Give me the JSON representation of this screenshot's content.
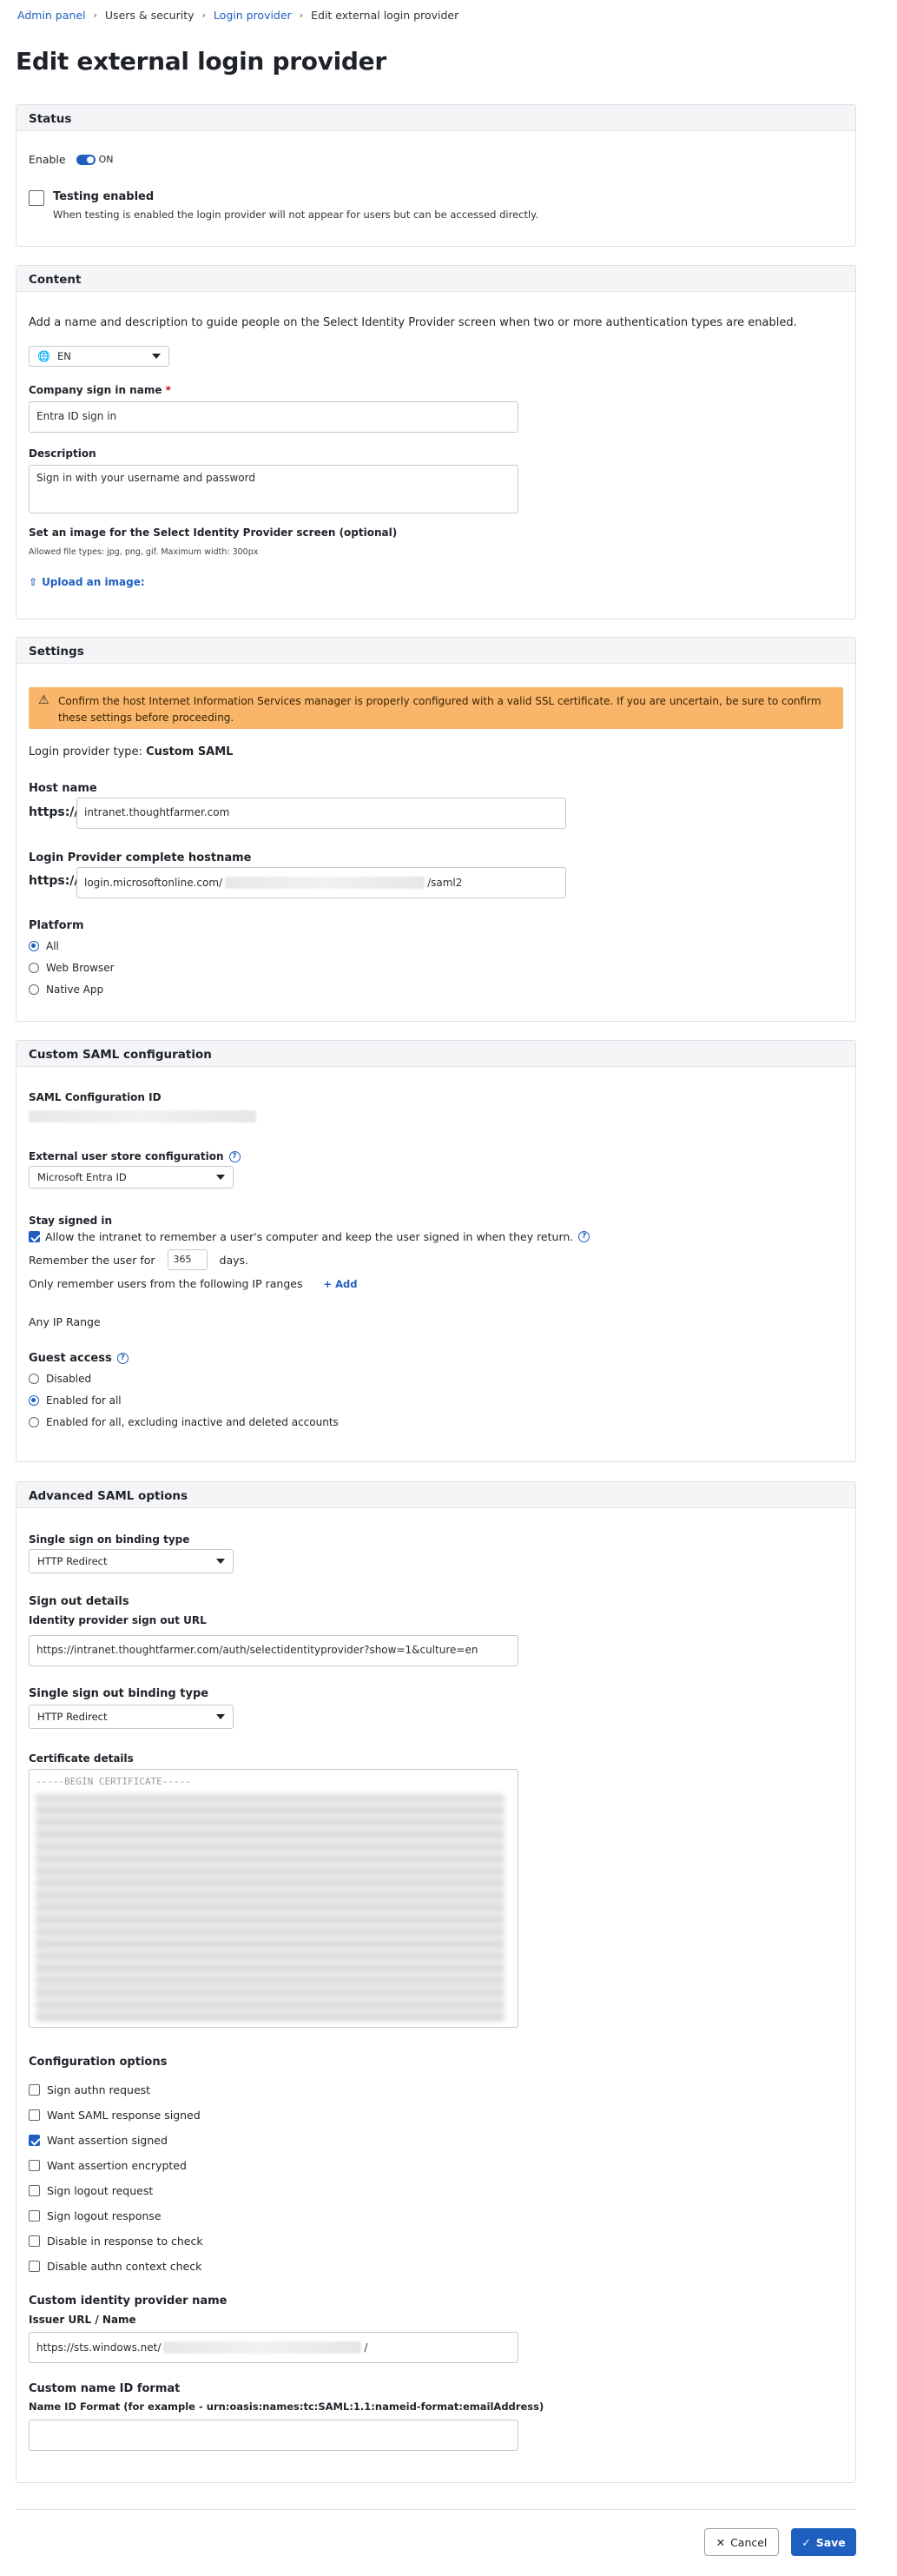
{
  "breadcrumb": {
    "items": [
      "Admin panel",
      "Users & security",
      "Login provider",
      "Edit external login provider"
    ]
  },
  "page_title": "Edit external login provider",
  "status": {
    "title": "Status",
    "enable_label": "Enable",
    "toggle_text": "ON",
    "testing_label": "Testing enabled",
    "testing_help": "When testing is enabled the login provider will not appear for users but can be accessed directly."
  },
  "content": {
    "title": "Content",
    "intro": "Add a name and description to guide people on the Select Identity Provider screen when two or more authentication types are enabled.",
    "language": "EN",
    "company_label": "Company sign in name",
    "required_mark": "*",
    "company_value": "Entra ID sign in",
    "description_label": "Description",
    "description_value": "Sign in with your username and password",
    "image_label": "Set an image for the Select Identity Provider screen (optional)",
    "image_help": "Allowed file types: jpg, png, gif. Maximum width: 300px",
    "upload_label": "Upload an image:"
  },
  "settings": {
    "title": "Settings",
    "warning": "Confirm the host Internet Information Services manager is properly configured with a valid SSL certificate. If you are uncertain, be sure to confirm these settings before proceeding.",
    "type_prefix": "Login provider type:",
    "type_value": "Custom SAML",
    "host_label": "Host name",
    "https": "https://",
    "host_value": "intranet.thoughtfarmer.com",
    "complete_label": "Login Provider complete hostname",
    "complete_prefix": "login.microsoftonline.com/",
    "complete_suffix": "/saml2",
    "platform_label": "Platform",
    "platforms": [
      "All",
      "Web Browser",
      "Native App"
    ]
  },
  "saml": {
    "title": "Custom SAML configuration",
    "config_id_label": "SAML Configuration ID",
    "store_label": "External user store configuration",
    "store_value": "Microsoft Entra ID",
    "stay_label": "Stay signed in",
    "stay_check": "Allow the intranet to remember a user's computer and keep the user signed in when they return.",
    "remember_prefix": "Remember the user for",
    "remember_days": "365",
    "remember_suffix": "days.",
    "ip_label": "Only remember users from the following IP ranges",
    "add_label": "Add",
    "any_ip": "Any IP Range",
    "guest_label": "Guest access",
    "guest_options": [
      "Disabled",
      "Enabled for all",
      "Enabled for all, excluding inactive and deleted accounts"
    ]
  },
  "advanced": {
    "title": "Advanced SAML options",
    "sso_binding_label": "Single sign on binding type",
    "sso_binding_value": "HTTP Redirect",
    "signout_label": "Sign out details",
    "idp_signout_label": "Identity provider sign out URL",
    "idp_signout_value": "https://intranet.thoughtfarmer.com/auth/selectidentityprovider?show=1&culture=en",
    "slo_binding_label": "Single sign out binding type",
    "slo_binding_value": "HTTP Redirect",
    "cert_label": "Certificate details",
    "cert_begin": "-----BEGIN CERTIFICATE-----",
    "config_label": "Configuration options",
    "options": [
      {
        "label": "Sign authn request",
        "checked": false
      },
      {
        "label": "Want SAML response signed",
        "checked": false
      },
      {
        "label": "Want assertion signed",
        "checked": true
      },
      {
        "label": "Want assertion encrypted",
        "checked": false
      },
      {
        "label": "Sign logout request",
        "checked": false
      },
      {
        "label": "Sign logout response",
        "checked": false
      },
      {
        "label": "Disable in response to check",
        "checked": false
      },
      {
        "label": "Disable authn context check",
        "checked": false
      }
    ],
    "idp_name_label": "Custom identity provider name",
    "issuer_label": "Issuer URL / Name",
    "issuer_prefix": "https://sts.windows.net/",
    "issuer_suffix": "/",
    "nameid_title": "Custom name ID format",
    "nameid_label": "Name ID Format (for example - urn:oasis:names:tc:SAML:1.1:nameid-format:emailAddress)"
  },
  "footer": {
    "cancel": "Cancel",
    "save": "Save"
  },
  "colors": {
    "accent": "#1f5fbf",
    "warning": "#f9b66b"
  }
}
